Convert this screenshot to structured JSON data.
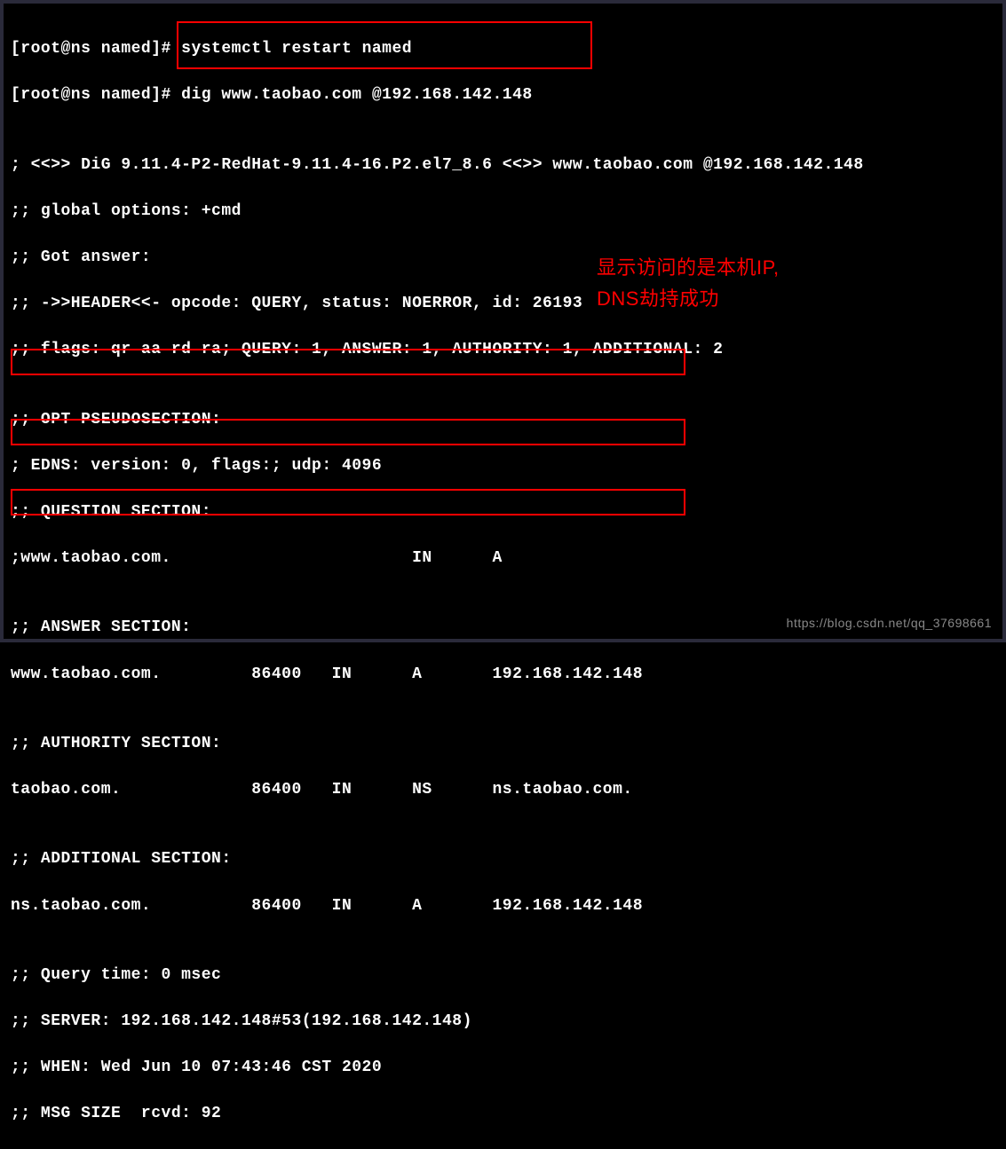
{
  "terminal": {
    "prompt1": "[root@ns named]# ",
    "cmd1": "systemctl restart named",
    "prompt2": "[root@ns named]# ",
    "cmd2": "dig www.taobao.com @192.168.142.148",
    "blank1": "",
    "version": "; <<>> DiG 9.11.4-P2-RedHat-9.11.4-16.P2.el7_8.6 <<>> www.taobao.com @192.168.142.148",
    "global_opts": ";; global options: +cmd",
    "got_answer": ";; Got answer:",
    "header": ";; ->>HEADER<<- opcode: QUERY, status: NOERROR, id: 26193",
    "flags": ";; flags: qr aa rd ra; QUERY: 1, ANSWER: 1, AUTHORITY: 1, ADDITIONAL: 2",
    "blank2": "",
    "opt_pseudo": ";; OPT PSEUDOSECTION:",
    "edns": "; EDNS: version: 0, flags:; udp: 4096",
    "question_hdr": ";; QUESTION SECTION:",
    "question": ";www.taobao.com.                        IN      A",
    "blank3": "",
    "answer_hdr": ";; ANSWER SECTION:",
    "answer": "www.taobao.com.         86400   IN      A       192.168.142.148",
    "blank4": "",
    "authority_hdr": ";; AUTHORITY SECTION:",
    "authority": "taobao.com.             86400   IN      NS      ns.taobao.com.",
    "blank5": "",
    "additional_hdr": ";; ADDITIONAL SECTION:",
    "additional": "ns.taobao.com.          86400   IN      A       192.168.142.148",
    "blank6": "",
    "query_time": ";; Query time: 0 msec",
    "server": ";; SERVER: 192.168.142.148#53(192.168.142.148)",
    "when": ";; WHEN: Wed Jun 10 07:43:46 CST 2020",
    "msg_size": ";; MSG SIZE  rcvd: 92"
  },
  "annotation": {
    "line1": "显示访问的是本机IP,",
    "line2": "DNS劫持成功"
  },
  "watermark": "https://blog.csdn.net/qq_37698661"
}
